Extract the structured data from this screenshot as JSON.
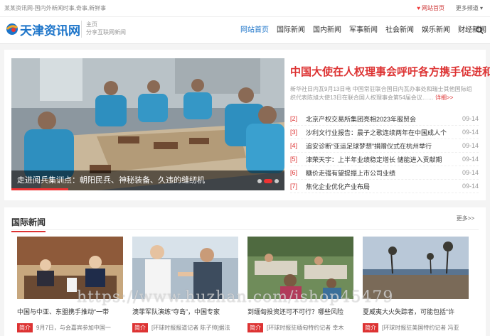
{
  "topbar": {
    "tagline": "某某资讯网-国内外新闻时事,奇事,新鲜事",
    "home_link": "网站首页",
    "more_link": "更多频道"
  },
  "header": {
    "logo_text": "天津资讯网",
    "slogan_1": "主页",
    "slogan_2": "分享互联网新闻",
    "nav": [
      "网站首页",
      "国际新闻",
      "国内新闻",
      "军事新闻",
      "社会新闻",
      "娱乐新闻",
      "财经新闻"
    ]
  },
  "banner": {
    "caption": "走进阅兵集训点：朝阳民兵、神秘装备、久违的缝纫机",
    "headline": "中国大使在人权理事会呼吁各方携手促进和",
    "summary": "新华社日内瓦9月13日电 中国常驻联合国日内瓦办事处和瑞士其他国际组织代表陈旭大使13日在联合国人权理事会第54届会议……",
    "detail_link": "详细>>",
    "news": [
      {
        "idx": "[2]",
        "title": "北京产权交易所集团亮相2023年服贸会",
        "date": "09-14"
      },
      {
        "idx": "[3]",
        "title": "沙利文行业报告：晨子之歌连续两年在中国成人个",
        "date": "09-14"
      },
      {
        "idx": "[4]",
        "title": "追安诊断“亚运足球梦想”捐赠仪式在杭州举行",
        "date": "09-14"
      },
      {
        "idx": "[5]",
        "title": "津荣天宇：上半年业绩稳定增长 储能进入贡献期",
        "date": "09-14"
      },
      {
        "idx": "[6]",
        "title": "糖价走强有望提振上市公司业绩",
        "date": "09-14"
      },
      {
        "idx": "[7]",
        "title": "焦化企业优化产业布局",
        "date": "09-14"
      }
    ]
  },
  "section": {
    "title": "国际新闻",
    "more": "更多>>",
    "tag_label": "简介",
    "cards": [
      {
        "title": "中国与中亚、东盟携手推动“一带",
        "desc": "9月7日，与会嘉宾参加中国一"
      },
      {
        "title": "澳菲军队演练“夺岛”，中国专家",
        "desc": "[环球时报报道记者 陈子帅]据法"
      },
      {
        "title": "到缅甸投资还可不可行？哪些风险",
        "desc": "[环球时报驻缅甸特约记者 幸木"
      },
      {
        "title": "夏威夷大火失踪者，可能包括“许",
        "desc": "[环球时报驻美国特约记者 冯亚"
      }
    ]
  },
  "watermark": "https://www.huzhan.com/ishop45479",
  "colors": {
    "brand": "#1c74c9",
    "accent": "#dd3333"
  }
}
